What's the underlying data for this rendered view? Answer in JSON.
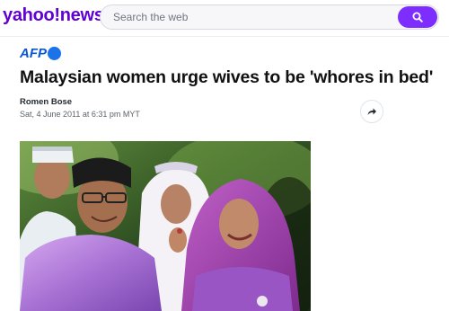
{
  "header": {
    "logo_text": "yahoo!news",
    "search_placeholder": "Search the web",
    "search_icon": "search-icon",
    "accent_color": "#7d2eff",
    "brand_color": "#6001d2"
  },
  "article": {
    "source": "AFP",
    "headline": "Malaysian women urge wives to be 'whores in bed'",
    "author": "Romen Bose",
    "date": "Sat, 4 June 2011 at 6:31 pm MYT",
    "share_icon": "share-icon"
  }
}
